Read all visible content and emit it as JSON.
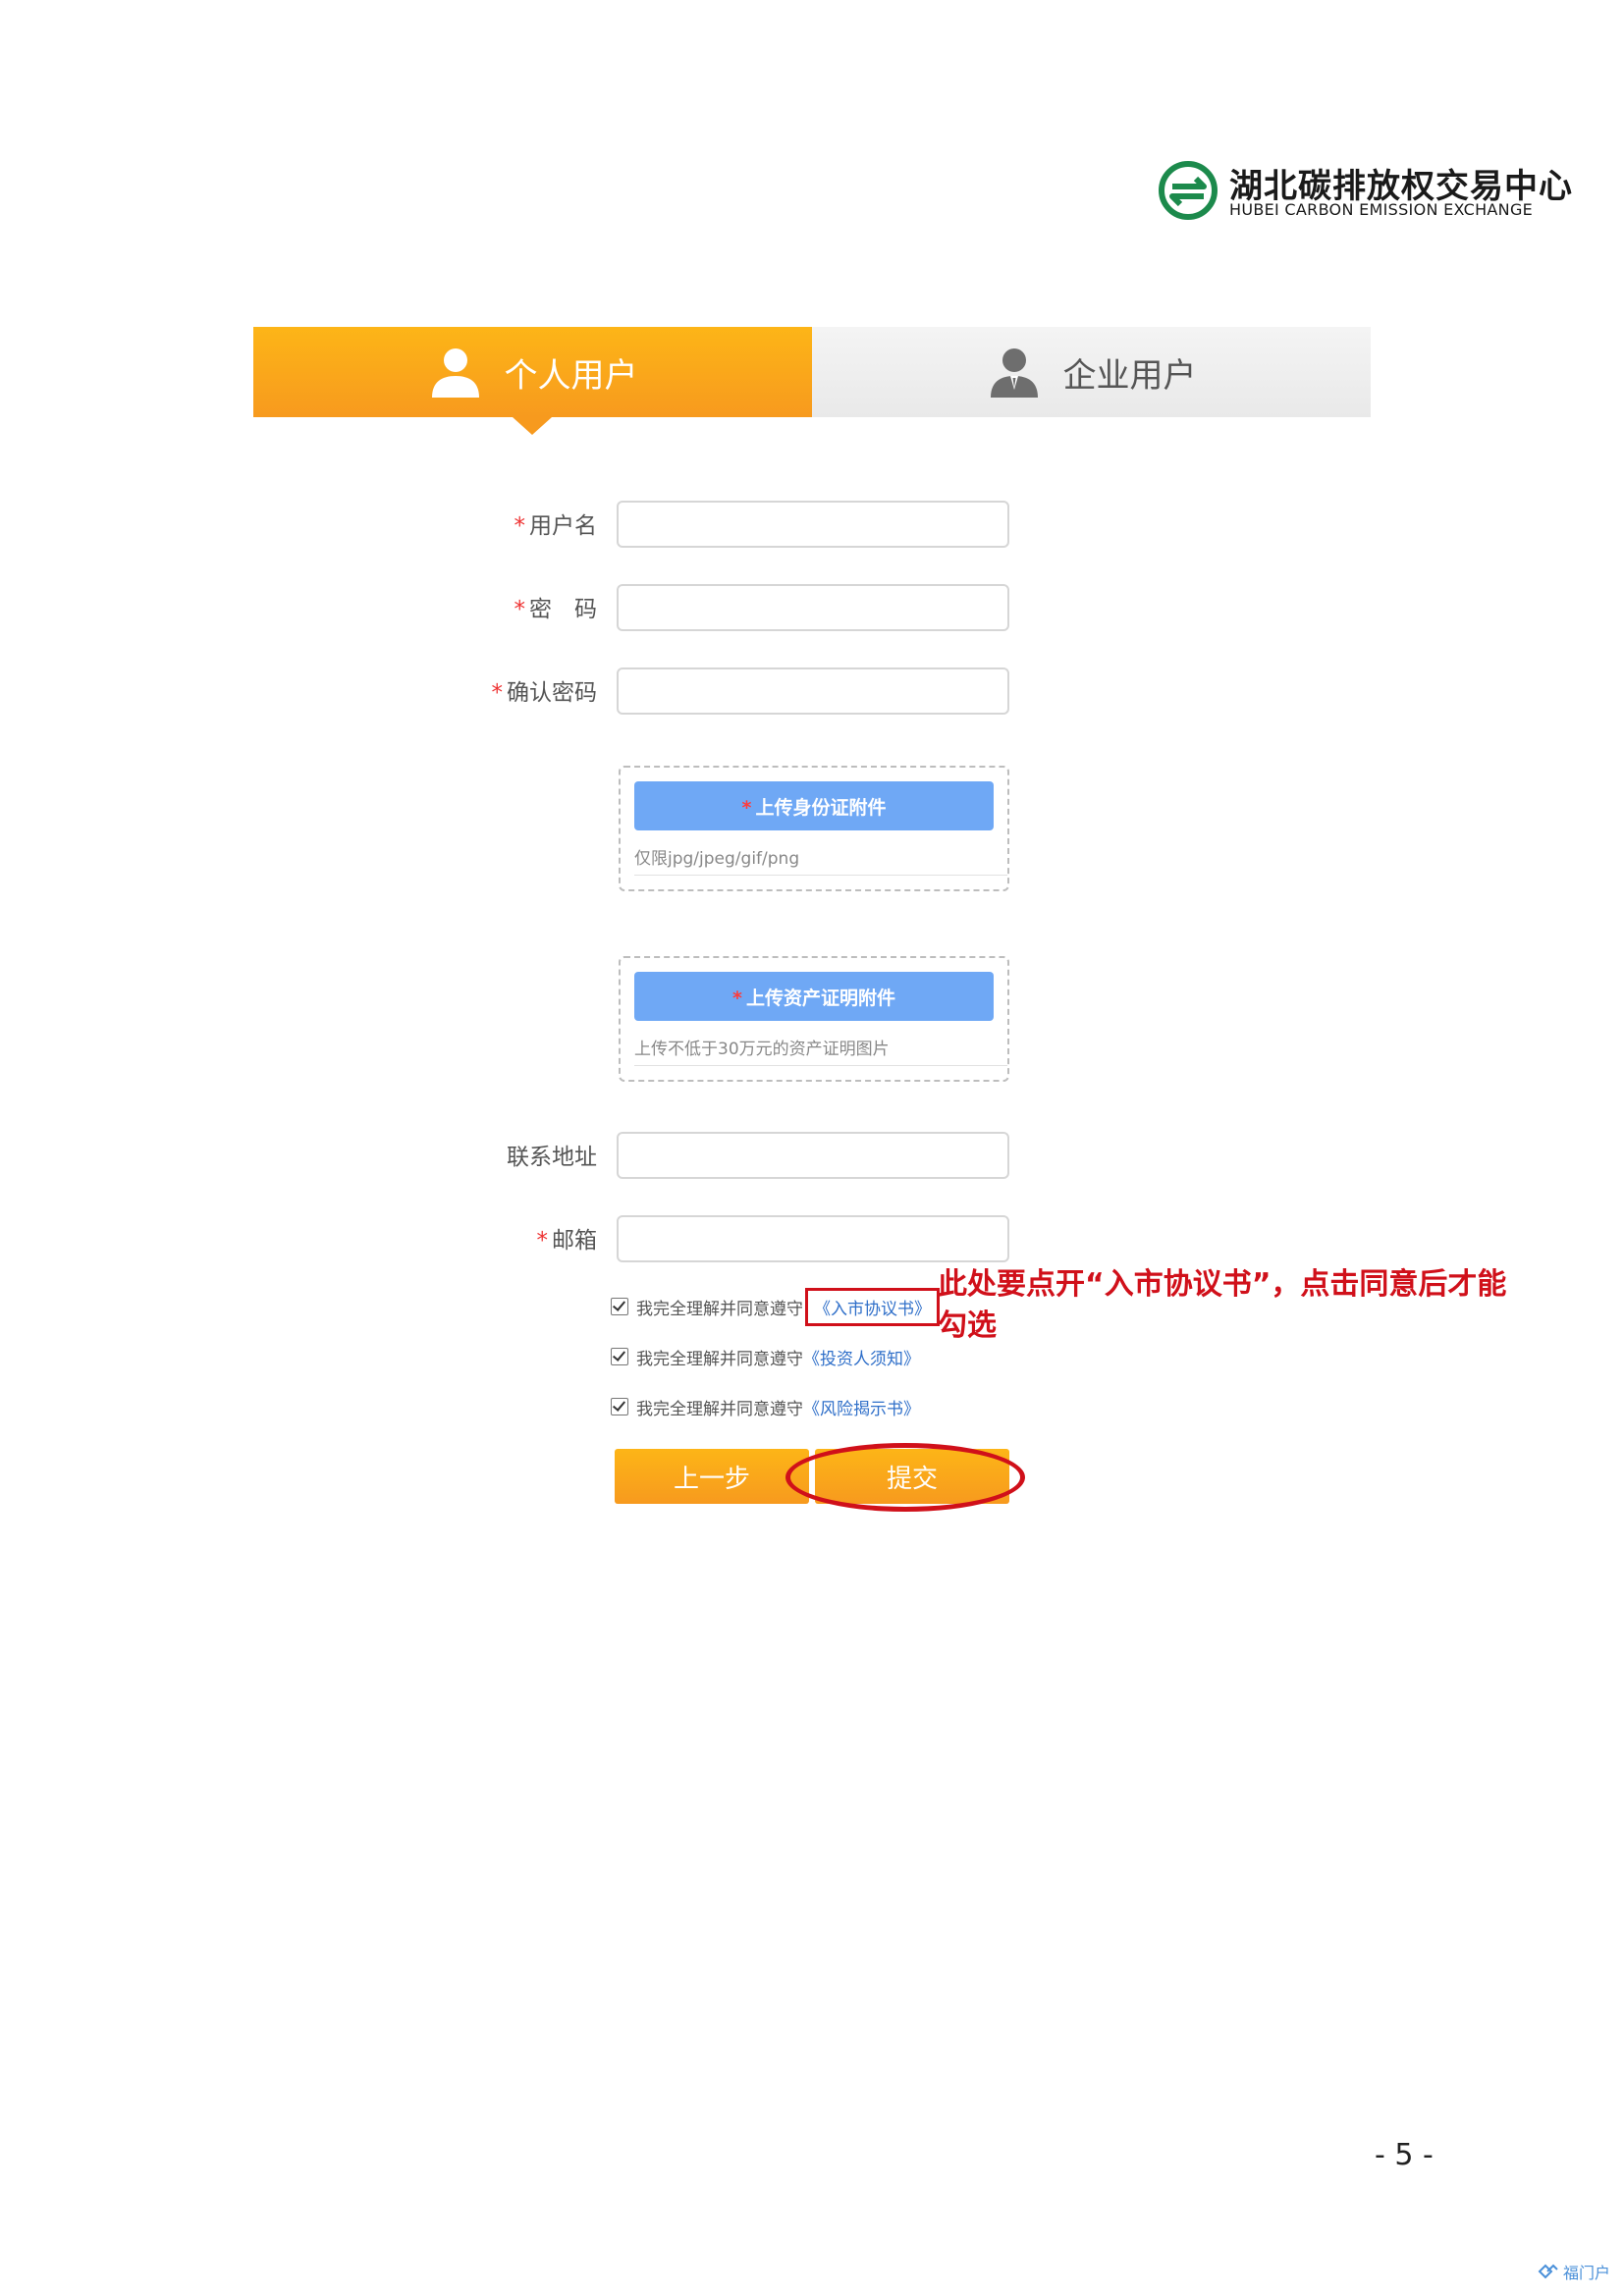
{
  "header": {
    "logo_cn": "湖北碳排放权交易中心",
    "logo_en": "HUBEI CARBON EMISSION EXCHANGE",
    "logo_icon": "carbon-exchange-logo-icon"
  },
  "tabs": [
    {
      "label": "个人用户",
      "icon": "person-icon",
      "active": true
    },
    {
      "label": "企业用户",
      "icon": "business-person-icon",
      "active": false
    }
  ],
  "form": {
    "required_mark": "*",
    "username": {
      "label": "用户名",
      "value": ""
    },
    "password": {
      "label": "密　码",
      "value": ""
    },
    "confirm_password": {
      "label": "确认密码",
      "value": ""
    },
    "upload_id": {
      "button": "上传身份证附件",
      "hint": "仅限jpg/jpeg/gif/png"
    },
    "upload_asset": {
      "button": "上传资产证明附件",
      "hint": "上传不低于30万元的资产证明图片"
    },
    "address": {
      "label": "联系地址",
      "value": ""
    },
    "email": {
      "label": "邮箱",
      "value": ""
    }
  },
  "agreements": {
    "prefix": "我完全理解并同意遵守",
    "items": [
      {
        "link": "《入市协议书》",
        "checked": true
      },
      {
        "link": "《投资人须知》",
        "checked": true
      },
      {
        "link": "《风险揭示书》",
        "checked": true
      }
    ]
  },
  "annotation": "此处要点开“入市协议书”，点击同意后才能勾选",
  "buttons": {
    "prev": "上一步",
    "submit": "提交"
  },
  "footer": {
    "page_number": "- 5 -",
    "watermark": "福门户"
  },
  "colors": {
    "accent_orange": "#f79a1e",
    "upload_blue": "#6fa8f5",
    "annotation_red": "#d0101a",
    "link_blue": "#2f6fc9"
  }
}
